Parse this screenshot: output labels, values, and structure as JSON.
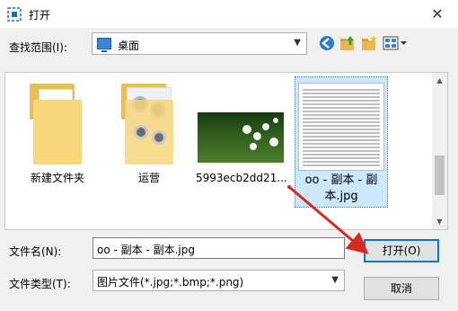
{
  "window": {
    "title": "打开",
    "close_glyph": "✕"
  },
  "lookin": {
    "label": "查找范围(I):",
    "value": "桌面"
  },
  "toolbar": {
    "back_icon": "back-arrow-icon",
    "up_icon": "up-folder-icon",
    "new_folder_icon": "new-folder-icon",
    "views_icon": "view-menu-icon"
  },
  "files": [
    {
      "name": "新建文件夹",
      "kind": "folder"
    },
    {
      "name": "运营",
      "kind": "folder-with-images"
    },
    {
      "name": "5993ecb2dd21...",
      "kind": "image"
    },
    {
      "name": "oo - 副本 - 副本.jpg",
      "kind": "document-image",
      "selected": true
    }
  ],
  "filename": {
    "label": "文件名(N):",
    "value": "oo - 副本 - 副本.jpg"
  },
  "filetype": {
    "label": "文件类型(T):",
    "value": "图片文件(*.jpg;*.bmp;*.png)"
  },
  "buttons": {
    "open": "打开(O)",
    "cancel": "取消"
  },
  "colors": {
    "accent": "#0078d7",
    "arrow": "#d42a22",
    "selection": "#cce8ff"
  }
}
